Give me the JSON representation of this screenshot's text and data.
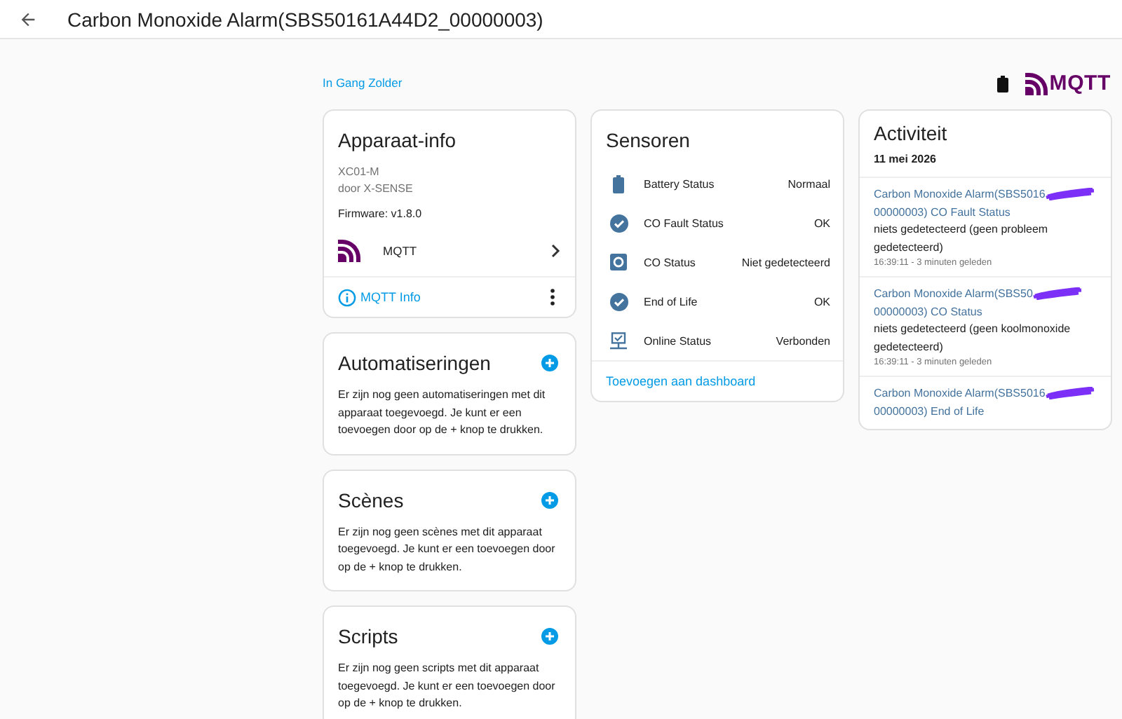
{
  "header": {
    "title": "Carbon Monoxide Alarm(SBS50161A44D2_00000003)"
  },
  "area_link": "In Gang Zolder",
  "brand": "MQTT",
  "device_info": {
    "title": "Apparaat-info",
    "model": "XC01-M",
    "manufacturer": "door X-SENSE",
    "firmware": "Firmware: v1.8.0",
    "integration": "MQTT",
    "info_link": "MQTT Info"
  },
  "sections": [
    {
      "title": "Automatiseringen",
      "text": "Er zijn nog geen automatiseringen met dit apparaat toegevoegd. Je kunt er een toevoegen door op de + knop te drukken."
    },
    {
      "title": "Scènes",
      "text": "Er zijn nog geen scènes met dit apparaat toegevoegd. Je kunt er een toevoegen door op de + knop te drukken."
    },
    {
      "title": "Scripts",
      "text": "Er zijn nog geen scripts met dit apparaat toegevoegd. Je kunt er een toevoegen door op de + knop te drukken."
    }
  ],
  "sensors": {
    "title": "Sensoren",
    "items": [
      {
        "name": "Battery Status",
        "state": "Normaal"
      },
      {
        "name": "CO Fault Status",
        "state": "OK"
      },
      {
        "name": "CO Status",
        "state": "Niet gedetecteerd"
      },
      {
        "name": "End of Life",
        "state": "OK"
      },
      {
        "name": "Online Status",
        "state": "Verbonden"
      }
    ],
    "add_link": "Toevoegen aan dashboard"
  },
  "activity": {
    "title": "Activiteit",
    "date": "11 mei 2026",
    "entries": [
      {
        "title_start": "Carbon Monoxide Alarm(SBS5016",
        "title_end": "00000003) CO Fault Status",
        "message": "niets gedetecteerd (geen probleem gedetecteerd)",
        "time": "16:39:11 - 3 minuten geleden"
      },
      {
        "title_start": "Carbon Monoxide Alarm(SBS50",
        "title_end": "00000003) CO Status",
        "message": "niets gedetecteerd (geen koolmonoxide gedetecteerd)",
        "time": "16:39:11 - 3 minuten geleden"
      },
      {
        "title_start": "Carbon Monoxide Alarm(SBS5016",
        "title_end": "00000003) End of Life"
      }
    ]
  }
}
